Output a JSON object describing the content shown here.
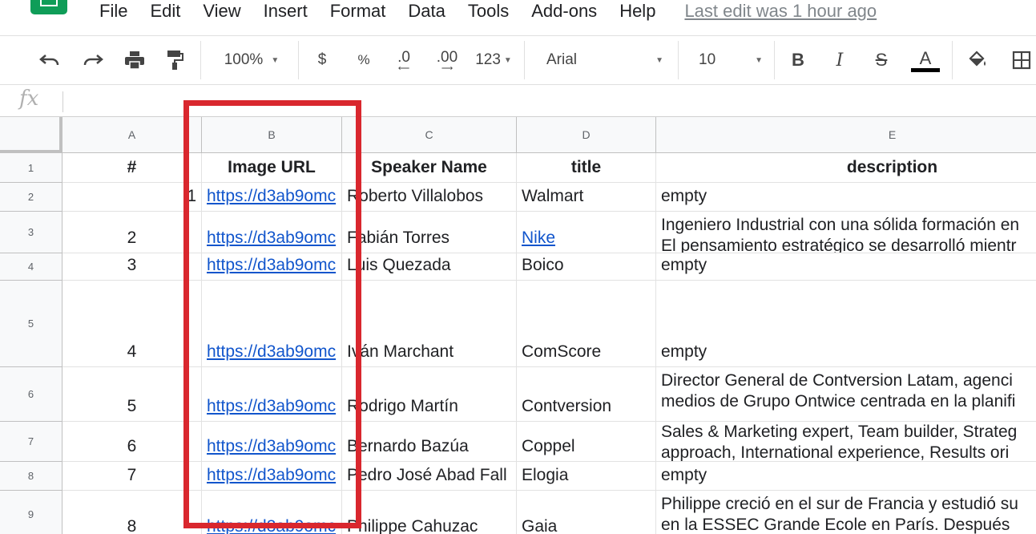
{
  "menu": {
    "items": [
      "File",
      "Edit",
      "View",
      "Insert",
      "Format",
      "Data",
      "Tools",
      "Add-ons",
      "Help"
    ],
    "last_edit": "Last edit was 1 hour ago"
  },
  "toolbar": {
    "zoom": "100%",
    "currency": "$",
    "percent": "%",
    "dec_decrease": ".0",
    "dec_increase": ".00",
    "more_formats": "123",
    "font": "Arial",
    "font_size": "10",
    "bold": "B",
    "italic": "I",
    "strike": "S",
    "text_color": "A"
  },
  "formula_bar": {
    "fx": "fx"
  },
  "columns": [
    "A",
    "B",
    "C",
    "D",
    "E"
  ],
  "rows": [
    "1",
    "2",
    "3",
    "4",
    "5",
    "6",
    "7",
    "8",
    "9"
  ],
  "headers": {
    "a": "#",
    "b": "Image URL",
    "c": "Speaker Name",
    "d": "title",
    "e": "description"
  },
  "data": [
    {
      "a": "1",
      "b": "https://d3ab9omc",
      "c": "Roberto Villalobos",
      "d": "Walmart",
      "e1": "empty",
      "e2": ""
    },
    {
      "a": "2",
      "b": "https://d3ab9omc",
      "c": "Fabián Torres",
      "d": "Nike",
      "e1": "Ingeniero Industrial con una sólida formación en",
      "e2": "El pensamiento estratégico se desarrolló mientr"
    },
    {
      "a": "3",
      "b": "https://d3ab9omc",
      "c": "Luis Quezada",
      "d": "Boico",
      "e1": "empty",
      "e2": ""
    },
    {
      "a": "4",
      "b": "https://d3ab9omc",
      "c": "Iván Marchant",
      "d": "ComScore",
      "e1": "empty",
      "e2": ""
    },
    {
      "a": "5",
      "b": "https://d3ab9omc",
      "c": "Rodrigo Martín",
      "d": "Contversion",
      "e1": "Director General de Contversion Latam, agenci",
      "e2": "medios de Grupo Ontwice centrada en la planifi"
    },
    {
      "a": "6",
      "b": "https://d3ab9omc",
      "c": "Bernardo Bazúa",
      "d": "Coppel",
      "e1": "Sales & Marketing expert, Team builder, Strateg",
      "e2": "approach, International experience, Results ori"
    },
    {
      "a": "7",
      "b": "https://d3ab9omc",
      "c": "Pedro José Abad Fall",
      "d": "Elogia",
      "e1": "empty",
      "e2": ""
    },
    {
      "a": "8",
      "b": "https://d3ab9omc",
      "c": "Philippe Cahuzac",
      "d": "Gaia",
      "e1": "Philippe creció en el sur de Francia y estudió su",
      "e2": "en la ESSEC Grande Ecole en París. Después"
    }
  ],
  "colors": {
    "accent_green": "#0f9d58",
    "link_blue": "#1155cc",
    "highlight_red": "#d9272e"
  }
}
